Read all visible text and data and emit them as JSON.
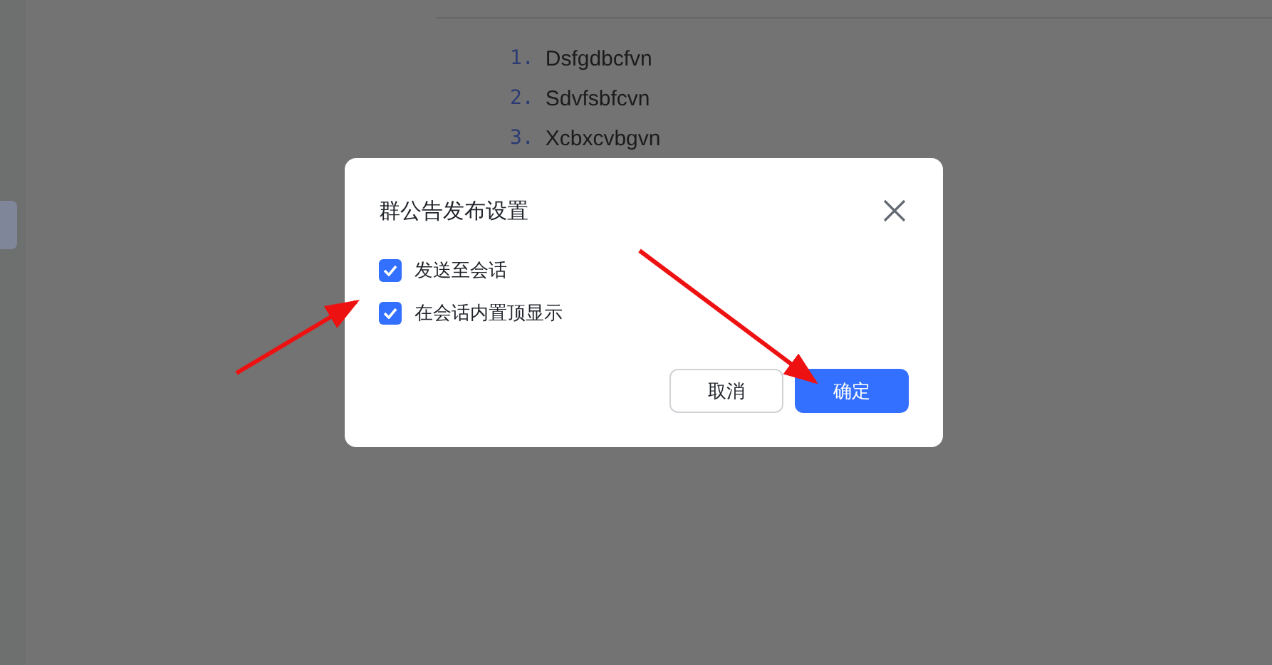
{
  "document": {
    "list": [
      {
        "number": "1.",
        "text": "Dsfgdbcfvn"
      },
      {
        "number": "2.",
        "text": "Sdvfsbfcvn"
      },
      {
        "number": "3.",
        "text": "Xcbxcvbgvn"
      }
    ]
  },
  "dialog": {
    "title": "群公告发布设置",
    "options": [
      {
        "label": "发送至会话",
        "checked": true
      },
      {
        "label": "在会话内置顶显示",
        "checked": true
      }
    ],
    "buttons": [
      {
        "label": "取消",
        "kind": "secondary"
      },
      {
        "label": "确定",
        "kind": "primary"
      }
    ]
  }
}
